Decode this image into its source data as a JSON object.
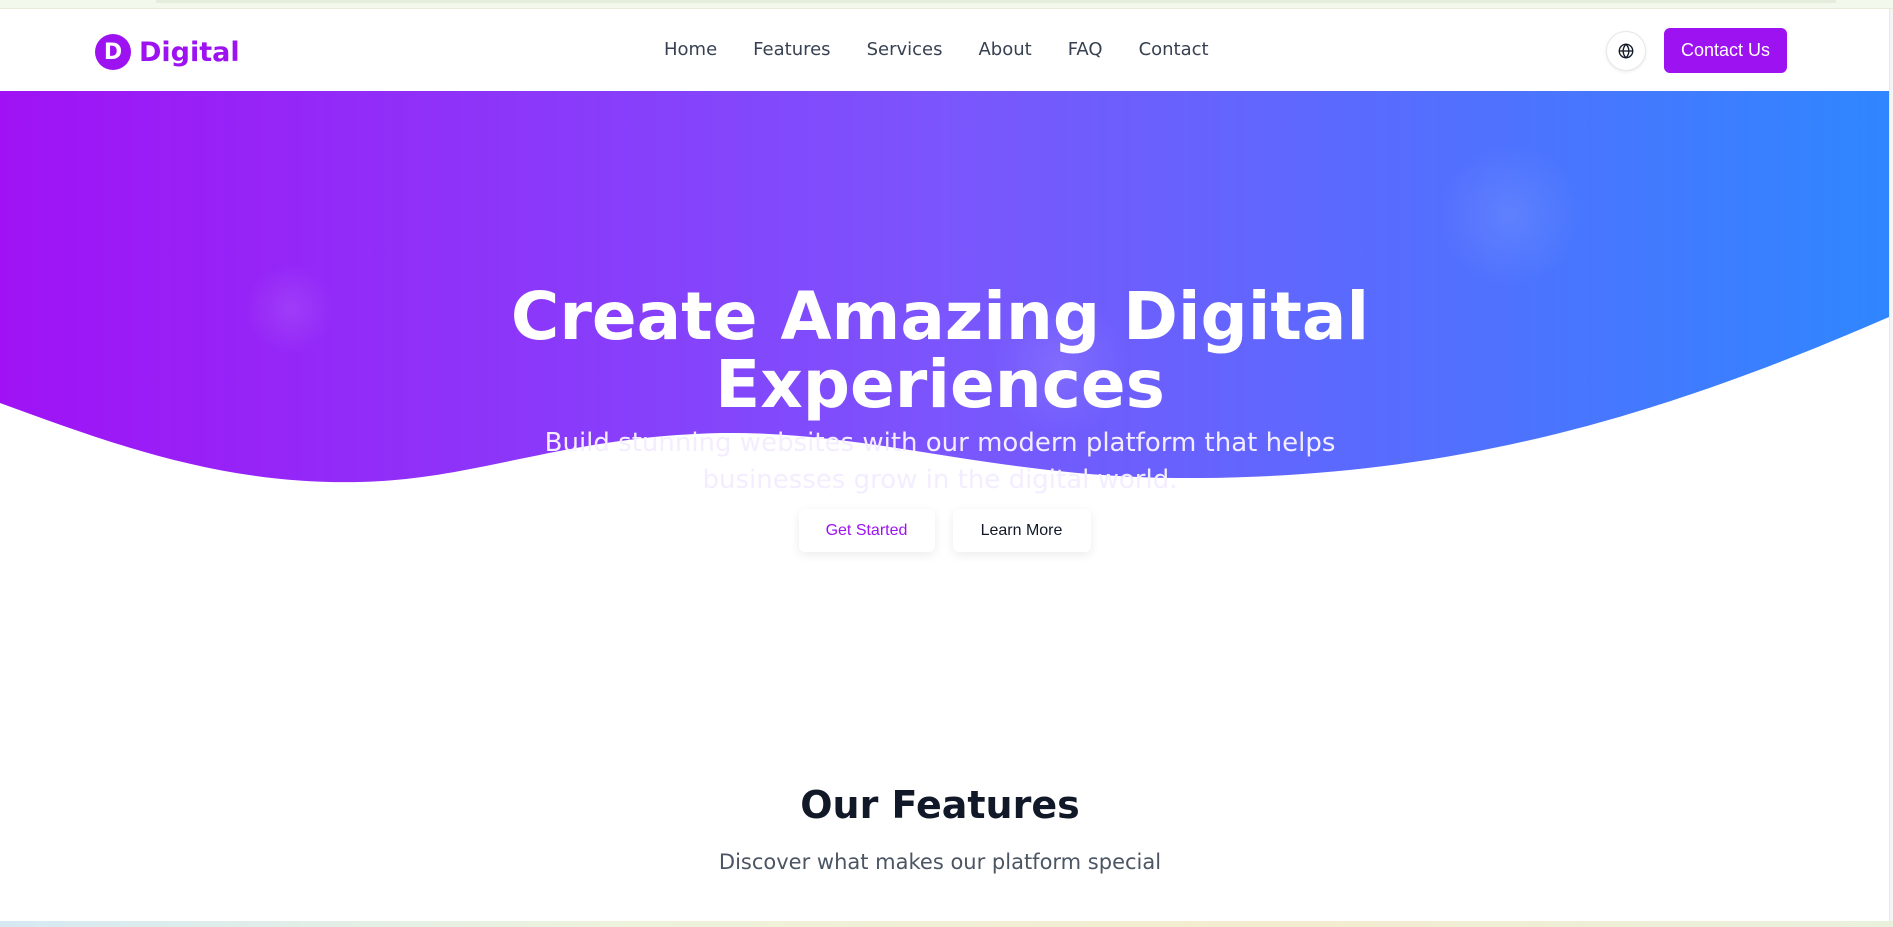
{
  "brand": {
    "logo_letter": "D",
    "name": "Digital",
    "color": "#9d12f0"
  },
  "nav": {
    "items": [
      {
        "label": "Home"
      },
      {
        "label": "Features"
      },
      {
        "label": "Services"
      },
      {
        "label": "About"
      },
      {
        "label": "FAQ"
      },
      {
        "label": "Contact"
      }
    ],
    "language_icon": "globe-icon",
    "contact_button": "Contact Us"
  },
  "hero": {
    "title": "Create Amazing Digital Experiences",
    "subtitle": "Build stunning websites with our modern platform that helps businesses grow in the digital world.",
    "gradient_start": "#a012f5",
    "gradient_mid": "#7b55fd",
    "gradient_end": "#2f86ff",
    "primary_button": "Get Started",
    "secondary_button": "Learn More"
  },
  "features": {
    "title": "Our Features",
    "subtitle": "Discover what makes our platform special"
  }
}
